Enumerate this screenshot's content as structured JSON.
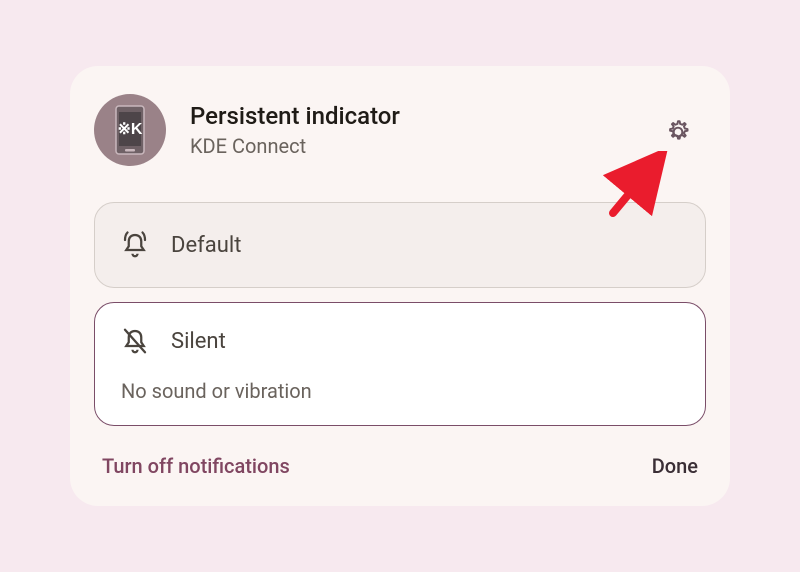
{
  "header": {
    "title": "Persistent indicator",
    "subtitle": "KDE Connect"
  },
  "options": {
    "default": {
      "label": "Default"
    },
    "silent": {
      "label": "Silent",
      "description": "No sound or vibration"
    }
  },
  "footer": {
    "turn_off": "Turn off notifications",
    "done": "Done"
  },
  "colors": {
    "accent": "#804661",
    "arrow": "#ea1c2d"
  }
}
